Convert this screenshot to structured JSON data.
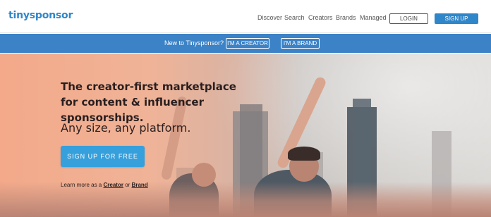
{
  "header": {
    "logo": "tinysponsor",
    "nav": [
      "Discover",
      "Search",
      "Creators",
      "Brands",
      "Managed"
    ],
    "login_label": "LOGIN",
    "signup_label": "SIGN UP"
  },
  "banner": {
    "text": "New to Tinysponsor?",
    "creator_button": "I'M A CREATOR",
    "brand_button": "I'M A BRAND"
  },
  "hero": {
    "headline": "The creator-first marketplace for content & influencer sponsorships.",
    "subheadline": "Any size, any platform.",
    "cta_label": "SIGN UP FOR FREE",
    "learn_prefix": "Learn more as a",
    "learn_creator": "Creator",
    "learn_or": "or",
    "learn_brand": "Brand"
  },
  "colors": {
    "brand_blue": "#2f86c9",
    "banner_blue": "#3b82c6",
    "cta_blue": "#36a0dc"
  }
}
